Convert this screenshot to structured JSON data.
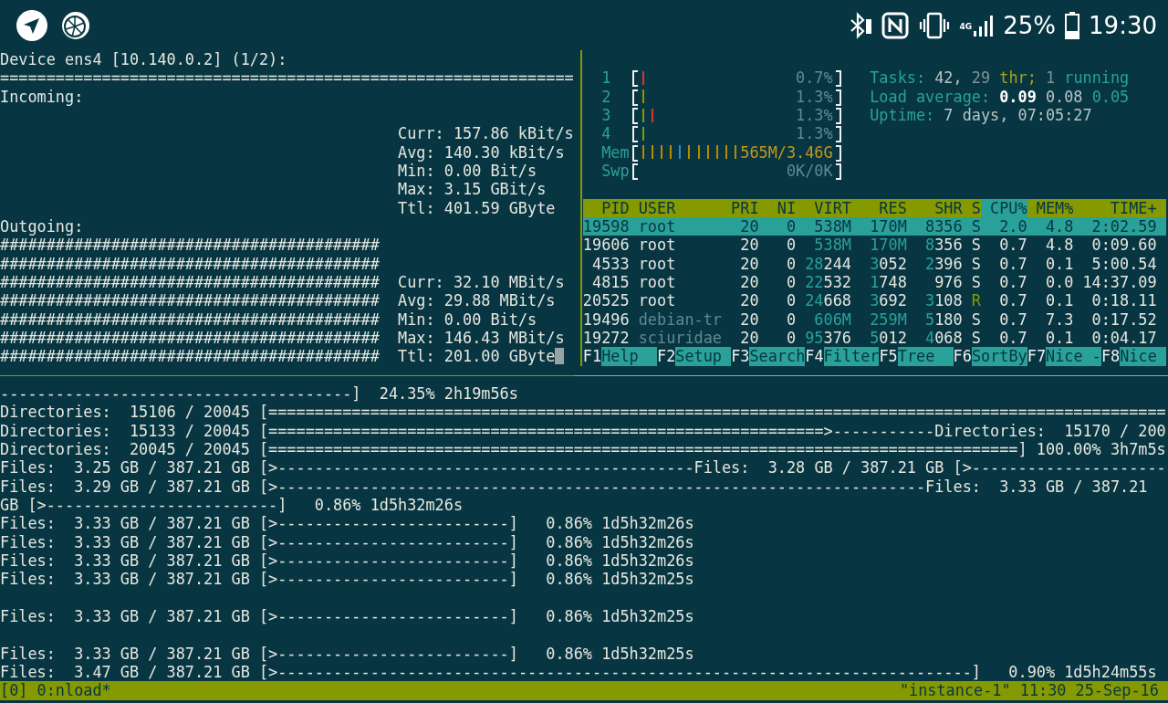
{
  "status_bar": {
    "network_type": "4G",
    "battery": "25%",
    "time": "19:30"
  },
  "nload": {
    "device": "Device ens4 [10.140.0.2] (1/2):",
    "separator": "==============================================================",
    "incoming": {
      "title": "Incoming:",
      "stats": [
        {
          "text": "Curr: 157.86 kBit/s",
          "cursor": false
        },
        {
          "text": "Avg: 140.30 kBit/s",
          "cursor": false
        },
        {
          "text": "Min: 0.00 Bit/s",
          "cursor": false
        },
        {
          "text": "Max: 3.15 GBit/s",
          "cursor": false
        },
        {
          "text": "Ttl: 401.59 GByte",
          "cursor": false
        }
      ]
    },
    "outgoing": {
      "title": "Outgoing:",
      "graph": [
        "#########################################",
        "#########################################",
        "#########################################",
        "#########################################",
        "#########################################",
        "#########################################",
        "#########################################"
      ],
      "stats": [
        {
          "text": "Curr: 32.10 MBit/s",
          "cursor": false
        },
        {
          "text": "Avg: 29.88 MBit/s",
          "cursor": false
        },
        {
          "text": "Min: 0.00 Bit/s",
          "cursor": false
        },
        {
          "text": "Max: 146.43 MBit/s",
          "cursor": false
        },
        {
          "text": "Ttl: 201.00 GByte",
          "cursor": true
        }
      ]
    }
  },
  "htop": {
    "meters": [
      {
        "label": "1",
        "kind": "cpu",
        "bars": [
          {
            "color": "#dc322f"
          }
        ],
        "reading": "0.7%"
      },
      {
        "label": "2",
        "kind": "cpu",
        "bars": [
          {
            "color": "#859900"
          }
        ],
        "reading": "1.3%"
      },
      {
        "label": "3",
        "kind": "cpu",
        "bars": [
          {
            "color": "#859900"
          },
          {
            "color": "#dc322f"
          }
        ],
        "reading": "1.3%"
      },
      {
        "label": "4",
        "kind": "cpu",
        "bars": [
          {
            "color": "#859900"
          }
        ],
        "reading": "1.3%"
      },
      {
        "label": "Mem",
        "kind": "mem",
        "bars": [
          {
            "color": "#b58900"
          },
          {
            "color": "#b58900"
          },
          {
            "color": "#b58900"
          },
          {
            "color": "#b58900"
          },
          {
            "color": "#268bd2"
          },
          {
            "color": "#b58900"
          },
          {
            "color": "#b58900"
          },
          {
            "color": "#b58900"
          },
          {
            "color": "#b58900"
          },
          {
            "color": "#b58900"
          },
          {
            "color": "#b58900"
          }
        ],
        "reading": "565M/3.46G"
      },
      {
        "label": "Swp",
        "kind": "swap",
        "reading": "0K/0K"
      }
    ],
    "info": [
      {
        "parts": [
          {
            "text": "Tasks:",
            "kind": "label"
          },
          {
            "text": "42,",
            "kind": "value"
          },
          {
            "text": "29",
            "kind": "dim"
          },
          {
            "text": "thr;",
            "kind": "thr"
          },
          {
            "text": "1",
            "kind": "dim"
          },
          {
            "text": "running",
            "kind": "label"
          }
        ]
      },
      {
        "parts": [
          {
            "text": "Load average:",
            "kind": "label"
          },
          {
            "text": "0.09",
            "kind": "bright"
          },
          {
            "text": "0.08",
            "kind": "value"
          },
          {
            "text": "0.05",
            "kind": "label"
          }
        ]
      },
      {
        "parts": [
          {
            "text": "Uptime:",
            "kind": "label"
          },
          {
            "text": "7 days, 07:05:27",
            "kind": "value"
          }
        ]
      }
    ],
    "columns": [
      {
        "label": "PID",
        "sorted": false
      },
      {
        "label": "USER",
        "sorted": false
      },
      {
        "label": "PRI",
        "sorted": false
      },
      {
        "label": "NI",
        "sorted": false
      },
      {
        "label": "VIRT",
        "sorted": false
      },
      {
        "label": "RES",
        "sorted": false
      },
      {
        "label": "SHR",
        "sorted": false
      },
      {
        "label": "S",
        "sorted": false
      },
      {
        "label": "CPU%",
        "sorted": true
      },
      {
        "label": "MEM%",
        "sorted": false
      },
      {
        "label": "TIME+",
        "sorted": false
      }
    ],
    "rows": [
      {
        "pid": "19598",
        "user": "root",
        "pri": "20",
        "ni": "0",
        "virt": "538M",
        "res": "170M",
        "shr": "8356",
        "s": "S",
        "cpu": "2.0",
        "mem": "4.8",
        "time": "2:02.59",
        "selected": true,
        "dimmed": false,
        "running": false
      },
      {
        "pid": "19606",
        "user": "root",
        "pri": "20",
        "ni": "0",
        "virt": "538M",
        "res": "170M",
        "shr": "8356",
        "s": "S",
        "cpu": "0.7",
        "mem": "4.8",
        "time": "0:09.60",
        "selected": false,
        "dimmed": false,
        "running": false
      },
      {
        "pid": "4533",
        "user": "root",
        "pri": "20",
        "ni": "0",
        "virt": "28244",
        "res": "3052",
        "shr": "2396",
        "s": "S",
        "cpu": "0.7",
        "mem": "0.1",
        "time": "5:00.54",
        "selected": false,
        "dimmed": false,
        "running": false
      },
      {
        "pid": "4815",
        "user": "root",
        "pri": "20",
        "ni": "0",
        "virt": "22532",
        "res": "1748",
        "shr": "976",
        "s": "S",
        "cpu": "0.7",
        "mem": "0.0",
        "time": "14:37.09",
        "selected": false,
        "dimmed": false,
        "running": false
      },
      {
        "pid": "20525",
        "user": "root",
        "pri": "20",
        "ni": "0",
        "virt": "24668",
        "res": "3692",
        "shr": "3108",
        "s": "R",
        "cpu": "0.7",
        "mem": "0.1",
        "time": "0:18.11",
        "selected": false,
        "dimmed": false,
        "running": true
      },
      {
        "pid": "19496",
        "user": "debian-tr",
        "pri": "20",
        "ni": "0",
        "virt": "606M",
        "res": "259M",
        "shr": "5180",
        "s": "S",
        "cpu": "0.7",
        "mem": "7.3",
        "time": "0:17.52",
        "selected": false,
        "dimmed": true,
        "running": false
      },
      {
        "pid": "19272",
        "user": "sciuridae",
        "pri": "20",
        "ni": "0",
        "virt": "95376",
        "res": "5012",
        "shr": "4068",
        "s": "S",
        "cpu": "0.7",
        "mem": "0.1",
        "time": "0:04.17",
        "selected": false,
        "dimmed": true,
        "running": false
      }
    ],
    "function_keys": [
      {
        "key": "F1",
        "label": "Help"
      },
      {
        "key": "F2",
        "label": "Setup"
      },
      {
        "key": "F3",
        "label": "Search"
      },
      {
        "key": "F4",
        "label": "Filter"
      },
      {
        "key": "F5",
        "label": "Tree"
      },
      {
        "key": "F6",
        "label": "SortBy"
      },
      {
        "key": "F7",
        "label": "Nice -"
      },
      {
        "key": "F8",
        "label": "Nice"
      }
    ]
  },
  "log_lines": [
    {
      "kind": "text",
      "text": "--------------------------------------]  24.35% 2h19m56s"
    },
    {
      "kind": "text",
      "text": "Directories:  15106 / 20045 [================================================================================================="
    },
    {
      "kind": "text",
      "text": "Directories:  15133 / 20045 [============================================================>-----------Directories:  15170 / 200"
    },
    {
      "kind": "text",
      "text": "Directories:  20045 / 20045 [=================================================================================] 100.00% 3h7m5s"
    },
    {
      "kind": "text",
      "text": "Files:  3.25 GB / 387.21 GB [>---------------------------------------------Files:  3.28 GB / 387.21 GB [>---------------------"
    },
    {
      "kind": "text",
      "text": "Files:  3.29 GB / 387.21 GB [>----------------------------------------------------------------------Files:  3.33 GB / 387.21"
    },
    {
      "kind": "text",
      "text": "GB [>-------------------------]   0.86% 1d5h32m26s"
    },
    {
      "kind": "text",
      "text": "Files:  3.33 GB / 387.21 GB [>-------------------------]   0.86% 1d5h32m26s"
    },
    {
      "kind": "text",
      "text": "Files:  3.33 GB / 387.21 GB [>-------------------------]   0.86% 1d5h32m26s"
    },
    {
      "kind": "text",
      "text": "Files:  3.33 GB / 387.21 GB [>-------------------------]   0.86% 1d5h32m26s"
    },
    {
      "kind": "text",
      "text": "Files:  3.33 GB / 387.21 GB [>-------------------------]   0.86% 1d5h32m25s"
    },
    {
      "kind": "blank"
    },
    {
      "kind": "text",
      "text": "Files:  3.33 GB / 387.21 GB [>-------------------------]   0.86% 1d5h32m25s"
    },
    {
      "kind": "blank"
    },
    {
      "kind": "text",
      "text": "Files:  3.33 GB / 387.21 GB [>-------------------------]   0.86% 1d5h32m25s"
    },
    {
      "kind": "text",
      "text": "Files:  3.47 GB / 387.21 GB [>---------------------------------------------------------------------------]   0.90% 1d5h24m55s"
    }
  ],
  "tmux": {
    "left": "[0] 0:nload*",
    "right": "\"instance-1\" 11:30 25-Sep-16"
  }
}
